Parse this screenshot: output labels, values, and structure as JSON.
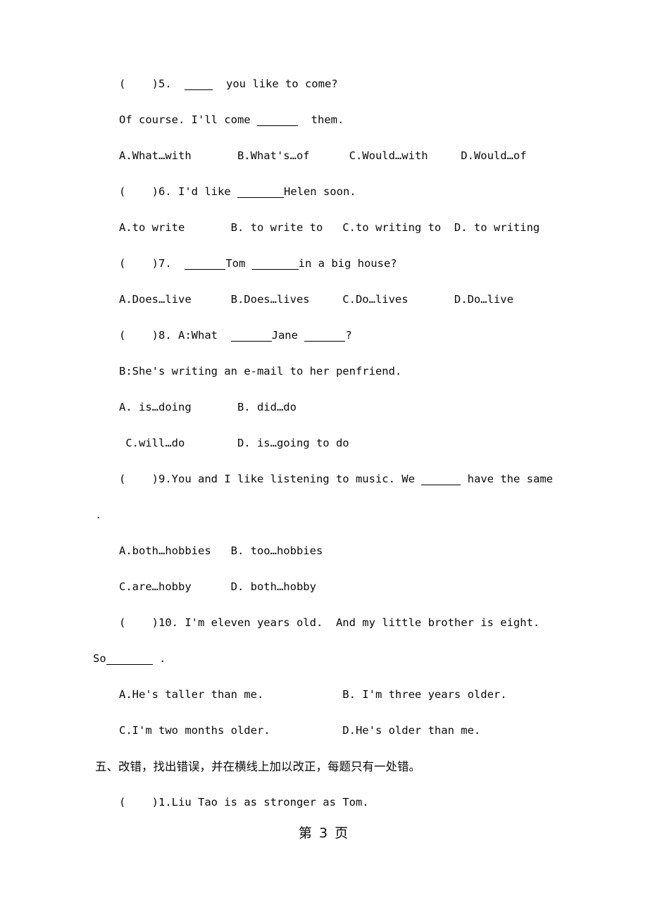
{
  "document": {
    "type": "exam-paper",
    "footer": "第 3 页",
    "page_number": "3"
  },
  "questions": [
    {
      "id": "q5",
      "marker": "(    )5.",
      "stem_pre": "(    )5.  ",
      "stem_post": "  you like to come?",
      "stem_full": "(    )5.  ____  you like to come?",
      "continuation_pre": "Of course. I'll come ",
      "continuation_post": "  them.",
      "continuation_full": "Of course. I'll come ______  them.",
      "options": [
        "A.What…with",
        "B.What's…of",
        "C.Would…with",
        "D.Would…of"
      ],
      "options_line": "A.What…with       B.What's…of      C.Would…with     D.Would…of"
    },
    {
      "id": "q6",
      "stem_pre": "(    )6. I'd like ",
      "stem_post": "Helen soon.",
      "stem_full": "(    )6. I'd like ______Helen soon.",
      "options": [
        "A.to write",
        "B. to write to",
        "C.to writing to",
        "D. to writing"
      ],
      "options_line": "A.to write       B. to write to   C.to writing to  D. to writing"
    },
    {
      "id": "q7",
      "stem_pre": "(    )7.  ",
      "stem_mid": "Tom ",
      "stem_post": "in a big house?",
      "stem_full": "(    )7.  ______Tom _______in a big house?",
      "options": [
        "A.Does…live",
        "B.Does…lives",
        "C.Do…lives",
        "D.Do…live"
      ],
      "options_line": "A.Does…live      B.Does…lives     C.Do…lives       D.Do…live"
    },
    {
      "id": "q8",
      "stem_pre": "(    )8. A:What  ",
      "stem_mid": "Jane ",
      "stem_post": "?",
      "stem_full": "(    )8. A:What  ______Jane ______?",
      "answer_line": "B:She's writing an e-mail to her penfriend.",
      "options_row1": [
        "A. is…doing",
        "B. did…do"
      ],
      "options_row2": [
        "C.will…do",
        "D. is…going to do"
      ],
      "options_line1": "A. is…doing       B. did…do",
      "options_line2": " C.will…do        D. is…going to do"
    },
    {
      "id": "q9",
      "stem_pre": "(    )9.You and I like listening to music. We ",
      "stem_post": " have the same",
      "stem_full": "(    )9.You and I like listening to music. We _____ have the same",
      "continuation": ".",
      "options_row1": [
        "A.both…hobbies",
        "B. too…hobbies"
      ],
      "options_row2": [
        "C.are…hobby",
        "D. both…hobby"
      ],
      "options_line1": "A.both…hobbies   B. too…hobbies",
      "options_line2": "C.are…hobby      D. both…hobby"
    },
    {
      "id": "q10",
      "stem_full": "(    )10. I'm eleven years old.  And my little brother is eight.",
      "continuation_pre": "So",
      "continuation_post": " .",
      "continuation_full": "So______ .",
      "options_row1": [
        "A.He's taller than me.",
        "B. I'm three years older."
      ],
      "options_row2": [
        "C.I'm two months older.",
        "D.He's older than me."
      ],
      "options_line1": "A.He's taller than me.            B. I'm three years older.",
      "options_line2": "C.I'm two months older.           D.He's older than me."
    }
  ],
  "section_five": {
    "heading": "五、改错，找出错误，并在横线上加以改正，每题只有一处错。",
    "items": [
      {
        "id": "s5q1",
        "text": "(    )1.Liu Tao is as stronger as Tom."
      }
    ]
  }
}
